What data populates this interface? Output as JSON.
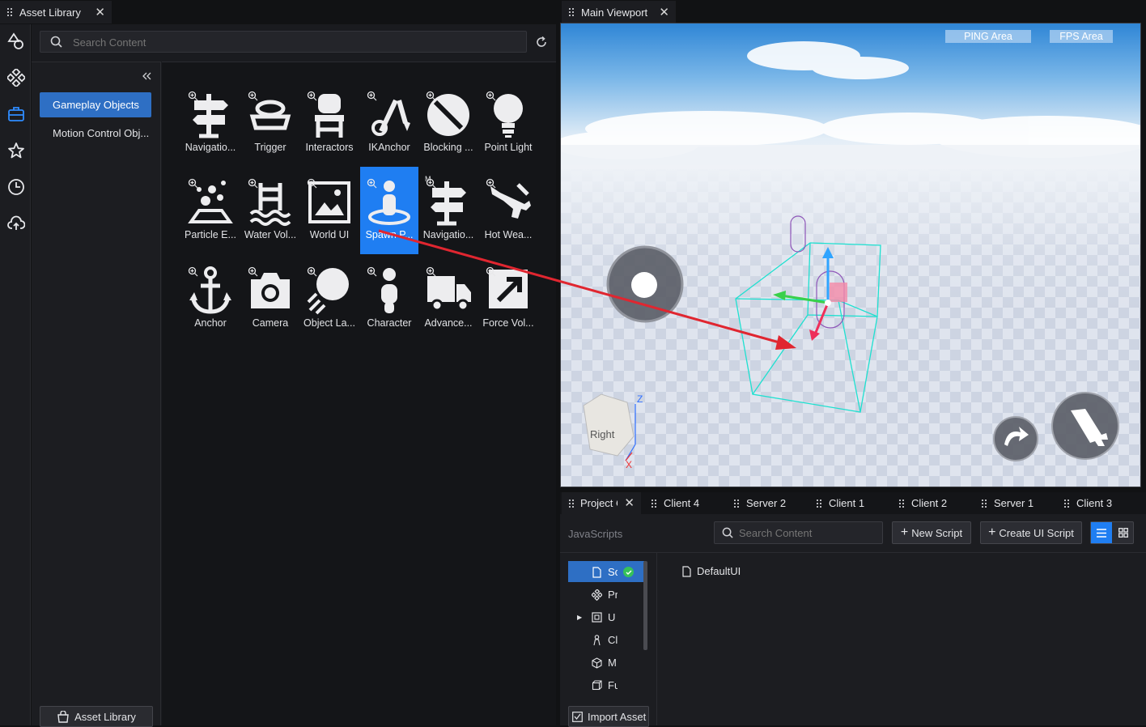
{
  "asset_tab": {
    "title": "Asset Library"
  },
  "viewport_tab": {
    "title": "Main Viewport"
  },
  "search": {
    "placeholder": "Search Content"
  },
  "categories": [
    {
      "label": "Gameplay Objects",
      "selected": true
    },
    {
      "label": "Motion Control Obj..."
    }
  ],
  "assets": [
    {
      "label": "Navigatio...",
      "icon": "signpost-icon"
    },
    {
      "label": "Trigger",
      "icon": "trigger-button-icon"
    },
    {
      "label": "Interactors",
      "icon": "chair-icon"
    },
    {
      "label": "IKAnchor",
      "icon": "ik-anchor-icon"
    },
    {
      "label": "Blocking ...",
      "icon": "blocking-icon"
    },
    {
      "label": "Point Light",
      "icon": "light-bulb-icon"
    },
    {
      "label": "Particle E...",
      "icon": "particle-icon"
    },
    {
      "label": "Water Vol...",
      "icon": "water-volume-icon"
    },
    {
      "label": "World UI",
      "icon": "world-ui-icon"
    },
    {
      "label": "Spawn P...",
      "icon": "spawn-point-icon",
      "selected": true
    },
    {
      "label": "Navigatio...",
      "icon": "signpost-icon",
      "badge": "M"
    },
    {
      "label": "Hot Wea...",
      "icon": "hot-weapon-icon"
    },
    {
      "label": "Anchor",
      "icon": "anchor-icon"
    },
    {
      "label": "Camera",
      "icon": "camera-icon"
    },
    {
      "label": "Object La...",
      "icon": "object-launcher-icon"
    },
    {
      "label": "Character",
      "icon": "character-icon"
    },
    {
      "label": "Advance...",
      "icon": "truck-icon"
    },
    {
      "label": "Force Vol...",
      "icon": "force-volume-icon"
    }
  ],
  "footer": {
    "asset_library_label": "Asset Library"
  },
  "viewport": {
    "ping_label": "PING Area",
    "fps_label": "FPS Area",
    "gizmo_face": "Right",
    "axis_z": "Z",
    "axis_x": "X"
  },
  "bottom_tabs": [
    {
      "label": "Project C",
      "active": true
    },
    {
      "label": "Client 4"
    },
    {
      "label": "Server 2"
    },
    {
      "label": "Client 1"
    },
    {
      "label": "Client 2"
    },
    {
      "label": "Server 1"
    },
    {
      "label": "Client 3"
    }
  ],
  "project": {
    "section_label": "JavaScripts",
    "search_placeholder": "Search Content",
    "new_script": "New Script",
    "create_ui_script": "Create UI Script",
    "tree": [
      {
        "label": "Sc",
        "icon": "file-icon",
        "selected": true
      },
      {
        "label": "Pr",
        "icon": "prefab-icon"
      },
      {
        "label": "U",
        "icon": "ui-icon",
        "expandable": true
      },
      {
        "label": "Cl",
        "icon": "character-icon"
      },
      {
        "label": "M",
        "icon": "cube-icon"
      },
      {
        "label": "Fu",
        "icon": "box-icon"
      }
    ],
    "files": [
      {
        "label": "DefaultUI"
      }
    ],
    "import_asset": "Import Asset"
  },
  "colors": {
    "accent": "#1f7ef2",
    "category_selected": "#2e6fc4",
    "arrow": "#e02630",
    "bbox": "#1ee0d0"
  }
}
